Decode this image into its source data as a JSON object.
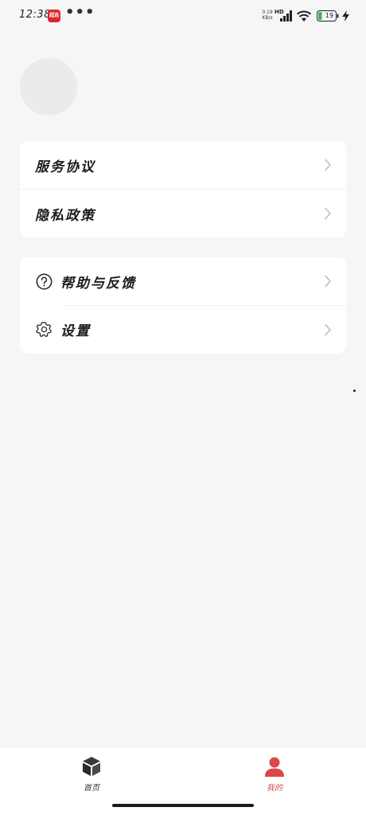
{
  "status_bar": {
    "time": "12:38",
    "app_badge": "超选",
    "more_dots": "•••",
    "net_speed_value": "0.19",
    "net_speed_unit": "KB/s",
    "hd": "HD",
    "battery_level": "19"
  },
  "menu": {
    "group1": [
      {
        "label": "服务协议"
      },
      {
        "label": "隐私政策"
      }
    ],
    "group2": [
      {
        "label": "帮助与反馈",
        "icon": "help-icon"
      },
      {
        "label": "设置",
        "icon": "settings-icon"
      }
    ]
  },
  "tab_bar": {
    "home_label": "首页",
    "mine_label": "我的",
    "active_color": "#d9474a"
  }
}
